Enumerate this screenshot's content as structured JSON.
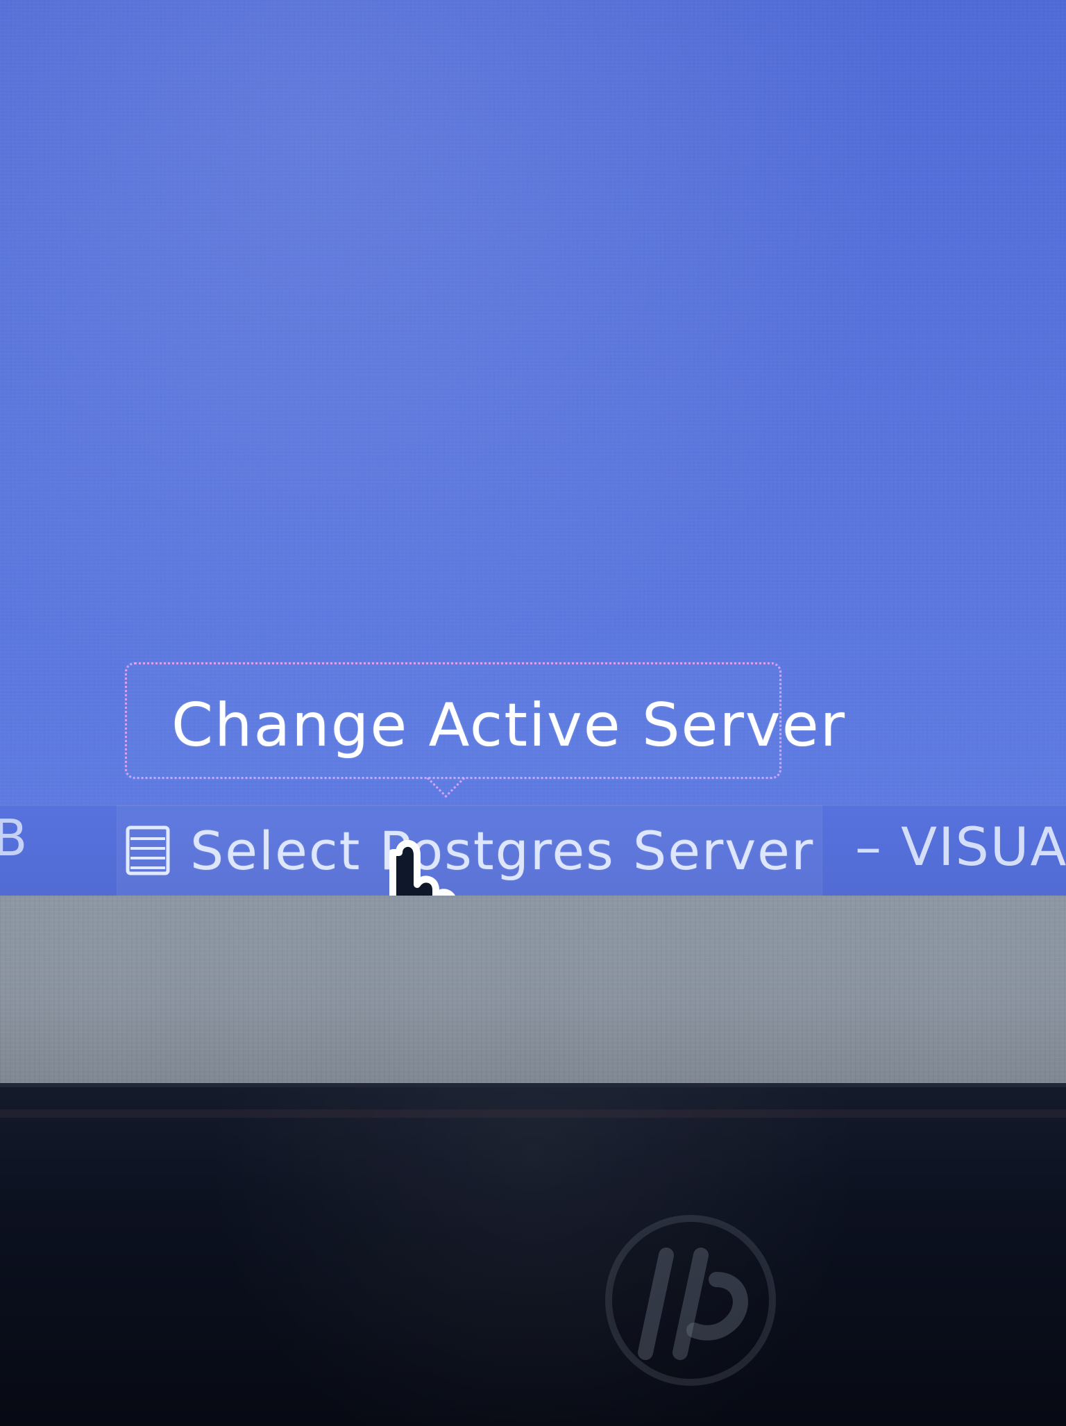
{
  "tooltip": {
    "text": "Change Active Server"
  },
  "statusbar": {
    "left_fragment": "B",
    "server_label": "Select Postgres Server",
    "right_fragment": "– VISUA",
    "icons": {
      "server": "server-icon",
      "cursor": "hand-pointer-icon"
    }
  },
  "device": {
    "logo_text": "hp"
  }
}
